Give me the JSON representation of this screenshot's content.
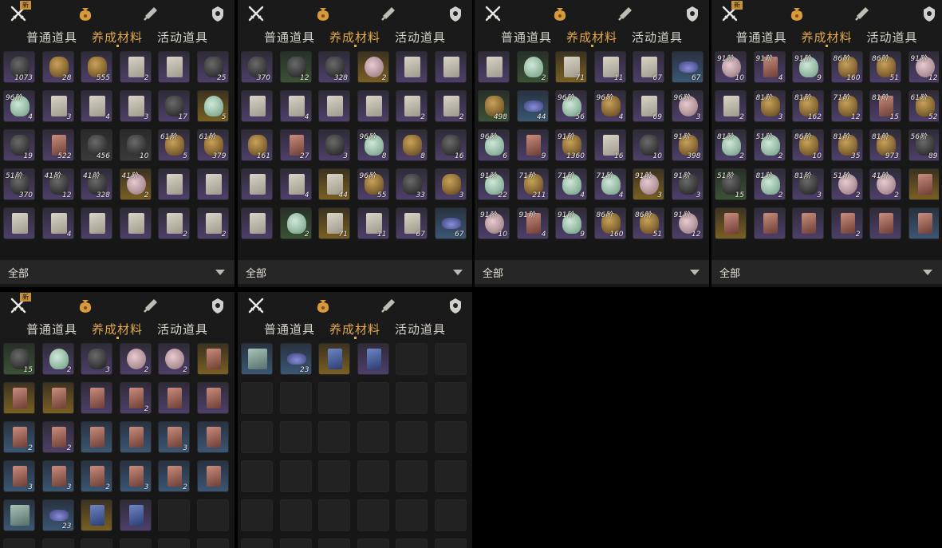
{
  "tabs": [
    "普通道具",
    "养成材料",
    "活动道具"
  ],
  "active_tab": 1,
  "new_badge": "新",
  "filter": {
    "selected": "全部"
  },
  "icons": [
    "crossed-swords-icon",
    "bag-icon",
    "scroll-icon",
    "shield-icon",
    "dropdown-arrow-icon"
  ],
  "colors": {
    "accent": "#e3a94a",
    "text": "#d8d4cc"
  },
  "panels": [
    {
      "id": "p0",
      "badge": true,
      "filter": true,
      "slots": [
        {
          "c": "purple",
          "i": "dark",
          "n": "1073"
        },
        {
          "c": "purple",
          "i": "ore",
          "n": "28"
        },
        {
          "c": "purple",
          "i": "ore",
          "n": "555"
        },
        {
          "c": "purple",
          "i": "paper",
          "n": "2"
        },
        {
          "c": "purple",
          "i": "paper",
          "n": ""
        },
        {
          "c": "purple",
          "i": "dark",
          "n": "25"
        },
        {
          "c": "purple",
          "i": "leaf",
          "t": "96阶",
          "n": "4"
        },
        {
          "c": "purple",
          "i": "paper",
          "n": "3"
        },
        {
          "c": "purple",
          "i": "paper",
          "n": "4"
        },
        {
          "c": "purple",
          "i": "paper",
          "n": "3"
        },
        {
          "c": "purple",
          "i": "dark",
          "n": "17"
        },
        {
          "c": "gold",
          "i": "leaf",
          "n": "5"
        },
        {
          "c": "purple",
          "i": "dark",
          "n": "19"
        },
        {
          "c": "purple",
          "i": "card",
          "n": "522"
        },
        {
          "c": "gray",
          "i": "dark",
          "n": "456"
        },
        {
          "c": "gray",
          "i": "dark",
          "n": "10"
        },
        {
          "c": "purple",
          "i": "ore",
          "t": "61阶",
          "n": "5"
        },
        {
          "c": "purple",
          "i": "ore",
          "t": "61阶",
          "n": "379"
        },
        {
          "c": "purple",
          "i": "dark",
          "t": "51阶",
          "n": "370"
        },
        {
          "c": "purple",
          "i": "dark",
          "t": "41阶",
          "n": "12"
        },
        {
          "c": "purple",
          "i": "dark",
          "t": "41阶",
          "n": "328"
        },
        {
          "c": "gold",
          "i": "shell",
          "t": "41阶",
          "n": "2"
        },
        {
          "c": "purple",
          "i": "paper",
          "n": ""
        },
        {
          "c": "purple",
          "i": "paper",
          "n": ""
        },
        {
          "c": "purple",
          "i": "paper",
          "n": ""
        },
        {
          "c": "purple",
          "i": "paper",
          "n": "4"
        },
        {
          "c": "purple",
          "i": "paper",
          "n": ""
        },
        {
          "c": "purple",
          "i": "paper",
          "n": ""
        },
        {
          "c": "purple",
          "i": "paper",
          "n": "2"
        },
        {
          "c": "purple",
          "i": "paper",
          "n": "2"
        }
      ]
    },
    {
      "id": "p1",
      "badge": false,
      "filter": true,
      "slots": [
        {
          "c": "purple",
          "i": "dark",
          "n": "370"
        },
        {
          "c": "green",
          "i": "dark",
          "n": "12"
        },
        {
          "c": "purple",
          "i": "dark",
          "n": "328"
        },
        {
          "c": "gold",
          "i": "shell",
          "n": "2"
        },
        {
          "c": "purple",
          "i": "paper",
          "n": ""
        },
        {
          "c": "purple",
          "i": "paper",
          "n": ""
        },
        {
          "c": "purple",
          "i": "paper",
          "n": ""
        },
        {
          "c": "purple",
          "i": "paper",
          "n": "4"
        },
        {
          "c": "purple",
          "i": "paper",
          "n": ""
        },
        {
          "c": "purple",
          "i": "paper",
          "n": ""
        },
        {
          "c": "purple",
          "i": "paper",
          "n": "2"
        },
        {
          "c": "purple",
          "i": "paper",
          "n": "2"
        },
        {
          "c": "purple",
          "i": "ore",
          "n": "161"
        },
        {
          "c": "purple",
          "i": "card",
          "n": "27"
        },
        {
          "c": "purple",
          "i": "dark",
          "n": "3"
        },
        {
          "c": "purple",
          "i": "leaf",
          "t": "96阶",
          "n": "8"
        },
        {
          "c": "purple",
          "i": "ore",
          "n": "8"
        },
        {
          "c": "purple",
          "i": "dark",
          "n": "16"
        },
        {
          "c": "purple",
          "i": "paper",
          "n": ""
        },
        {
          "c": "purple",
          "i": "paper",
          "n": "4"
        },
        {
          "c": "gold",
          "i": "paper",
          "n": "44"
        },
        {
          "c": "purple",
          "i": "ore",
          "t": "96阶",
          "n": "55"
        },
        {
          "c": "purple",
          "i": "dark",
          "n": "33"
        },
        {
          "c": "purple",
          "i": "ore",
          "n": "3"
        },
        {
          "c": "purple",
          "i": "paper",
          "n": ""
        },
        {
          "c": "green",
          "i": "leaf",
          "n": "2"
        },
        {
          "c": "gold",
          "i": "paper",
          "n": "71"
        },
        {
          "c": "purple",
          "i": "paper",
          "n": "11"
        },
        {
          "c": "purple",
          "i": "paper",
          "n": "67"
        },
        {
          "c": "blue",
          "i": "boat",
          "n": "67"
        }
      ]
    },
    {
      "id": "p2",
      "badge": false,
      "filter": true,
      "slots": [
        {
          "c": "purple",
          "i": "paper",
          "n": ""
        },
        {
          "c": "green",
          "i": "leaf",
          "n": "2"
        },
        {
          "c": "gold",
          "i": "paper",
          "n": "71"
        },
        {
          "c": "purple",
          "i": "paper",
          "n": "11"
        },
        {
          "c": "purple",
          "i": "paper",
          "n": "67"
        },
        {
          "c": "blue",
          "i": "boat",
          "n": "67"
        },
        {
          "c": "green",
          "i": "ore",
          "n": "498"
        },
        {
          "c": "blue",
          "i": "boat",
          "n": "44"
        },
        {
          "c": "purple",
          "i": "leaf",
          "t": "96阶",
          "n": "56"
        },
        {
          "c": "purple",
          "i": "ore",
          "t": "96阶",
          "n": "4"
        },
        {
          "c": "purple",
          "i": "paper",
          "n": "69"
        },
        {
          "c": "purple",
          "i": "shell",
          "t": "96阶",
          "n": "3"
        },
        {
          "c": "purple",
          "i": "leaf",
          "t": "96阶",
          "n": "6"
        },
        {
          "c": "purple",
          "i": "card",
          "n": "9"
        },
        {
          "c": "purple",
          "i": "ore",
          "t": "91阶",
          "n": "1360"
        },
        {
          "c": "purple",
          "i": "paper",
          "n": "16"
        },
        {
          "c": "purple",
          "i": "dark",
          "n": "10"
        },
        {
          "c": "purple",
          "i": "ore",
          "t": "91阶",
          "n": "398"
        },
        {
          "c": "purple",
          "i": "leaf",
          "t": "91阶",
          "n": "22"
        },
        {
          "c": "purple",
          "i": "ore",
          "t": "71阶",
          "n": "211"
        },
        {
          "c": "purple",
          "i": "leaf",
          "t": "71阶",
          "n": "4"
        },
        {
          "c": "purple",
          "i": "leaf",
          "t": "71阶",
          "n": "4"
        },
        {
          "c": "gold",
          "i": "shell",
          "t": "91阶",
          "n": "3"
        },
        {
          "c": "purple",
          "i": "dark",
          "t": "91阶",
          "n": "3"
        },
        {
          "c": "purple",
          "i": "shell",
          "t": "91阶",
          "n": "10"
        },
        {
          "c": "purple",
          "i": "card",
          "t": "91阶",
          "n": "4"
        },
        {
          "c": "purple",
          "i": "leaf",
          "t": "91阶",
          "n": "9"
        },
        {
          "c": "purple",
          "i": "ore",
          "t": "86阶",
          "n": "160"
        },
        {
          "c": "purple",
          "i": "ore",
          "t": "86阶",
          "n": "51"
        },
        {
          "c": "purple",
          "i": "shell",
          "t": "91阶",
          "n": "12"
        }
      ]
    },
    {
      "id": "p3",
      "badge": true,
      "filter": true,
      "slots": [
        {
          "c": "purple",
          "i": "shell",
          "t": "91阶",
          "n": "10"
        },
        {
          "c": "purple",
          "i": "card",
          "t": "91阶",
          "n": "4"
        },
        {
          "c": "purple",
          "i": "leaf",
          "t": "91阶",
          "n": "9"
        },
        {
          "c": "purple",
          "i": "ore",
          "t": "86阶",
          "n": "160"
        },
        {
          "c": "purple",
          "i": "ore",
          "t": "86阶",
          "n": "51"
        },
        {
          "c": "purple",
          "i": "shell",
          "t": "91阶",
          "n": "12"
        },
        {
          "c": "purple",
          "i": "paper",
          "n": "2"
        },
        {
          "c": "purple",
          "i": "ore",
          "t": "81阶",
          "n": "3"
        },
        {
          "c": "purple",
          "i": "ore",
          "t": "81阶",
          "n": "162"
        },
        {
          "c": "purple",
          "i": "ore",
          "t": "71阶",
          "n": "12"
        },
        {
          "c": "purple",
          "i": "card",
          "t": "81阶",
          "n": "15"
        },
        {
          "c": "purple",
          "i": "ore",
          "t": "61阶",
          "n": "52"
        },
        {
          "c": "purple",
          "i": "leaf",
          "t": "81阶",
          "n": "2"
        },
        {
          "c": "purple",
          "i": "leaf",
          "t": "51阶",
          "n": "2"
        },
        {
          "c": "purple",
          "i": "ore",
          "t": "86阶",
          "n": "10"
        },
        {
          "c": "purple",
          "i": "ore",
          "t": "81阶",
          "n": "35"
        },
        {
          "c": "purple",
          "i": "ore",
          "t": "81阶",
          "n": "973"
        },
        {
          "c": "purple",
          "i": "dark",
          "t": "56阶",
          "n": "89"
        },
        {
          "c": "green",
          "i": "dark",
          "t": "51阶",
          "n": "15"
        },
        {
          "c": "purple",
          "i": "leaf",
          "t": "81阶",
          "n": "2"
        },
        {
          "c": "purple",
          "i": "dark",
          "t": "81阶",
          "n": "3"
        },
        {
          "c": "purple",
          "i": "shell",
          "t": "51阶",
          "n": "2"
        },
        {
          "c": "purple",
          "i": "shell",
          "t": "41阶",
          "n": "2"
        },
        {
          "c": "gold",
          "i": "card",
          "n": ""
        },
        {
          "c": "gold",
          "i": "card",
          "n": ""
        },
        {
          "c": "purple",
          "i": "card",
          "n": ""
        },
        {
          "c": "purple",
          "i": "card",
          "n": ""
        },
        {
          "c": "purple",
          "i": "card",
          "n": "2"
        },
        {
          "c": "purple",
          "i": "card",
          "n": ""
        },
        {
          "c": "blue",
          "i": "card",
          "n": ""
        }
      ]
    },
    {
      "id": "p4",
      "badge": true,
      "filter": false,
      "slots": [
        {
          "c": "green",
          "i": "dark",
          "n": "15"
        },
        {
          "c": "purple",
          "i": "leaf",
          "n": "2"
        },
        {
          "c": "purple",
          "i": "dark",
          "n": "3"
        },
        {
          "c": "purple",
          "i": "shell",
          "n": "2"
        },
        {
          "c": "purple",
          "i": "shell",
          "n": "2"
        },
        {
          "c": "gold",
          "i": "card",
          "n": ""
        },
        {
          "c": "gold",
          "i": "card",
          "n": ""
        },
        {
          "c": "gold",
          "i": "card",
          "n": ""
        },
        {
          "c": "purple",
          "i": "card",
          "n": ""
        },
        {
          "c": "purple",
          "i": "card",
          "n": "2"
        },
        {
          "c": "purple",
          "i": "card",
          "n": ""
        },
        {
          "c": "purple",
          "i": "card",
          "n": ""
        },
        {
          "c": "blue",
          "i": "card",
          "n": "2"
        },
        {
          "c": "purple",
          "i": "card",
          "n": "2"
        },
        {
          "c": "blue",
          "i": "card",
          "n": ""
        },
        {
          "c": "blue",
          "i": "card",
          "n": ""
        },
        {
          "c": "blue",
          "i": "card",
          "n": "3"
        },
        {
          "c": "blue",
          "i": "card",
          "n": ""
        },
        {
          "c": "blue",
          "i": "card",
          "n": "3"
        },
        {
          "c": "blue",
          "i": "card",
          "n": "3"
        },
        {
          "c": "blue",
          "i": "card",
          "n": "2"
        },
        {
          "c": "blue",
          "i": "card",
          "n": "3"
        },
        {
          "c": "blue",
          "i": "card",
          "n": "2"
        },
        {
          "c": "blue",
          "i": "card",
          "n": ""
        },
        {
          "c": "blue",
          "i": "book",
          "n": ""
        },
        {
          "c": "blue",
          "i": "boat",
          "n": "23"
        },
        {
          "c": "gold",
          "i": "bluecard",
          "n": ""
        },
        {
          "c": "purple",
          "i": "bluecard",
          "n": ""
        },
        {
          "c": "empty",
          "i": "",
          "n": ""
        },
        {
          "c": "empty",
          "i": "",
          "n": ""
        },
        {
          "c": "empty",
          "i": "",
          "n": ""
        },
        {
          "c": "empty",
          "i": "",
          "n": ""
        },
        {
          "c": "empty",
          "i": "",
          "n": ""
        },
        {
          "c": "empty",
          "i": "",
          "n": ""
        },
        {
          "c": "empty",
          "i": "",
          "n": ""
        },
        {
          "c": "empty",
          "i": "",
          "n": ""
        }
      ]
    },
    {
      "id": "p5",
      "badge": false,
      "filter": false,
      "slots": [
        {
          "c": "blue",
          "i": "book",
          "n": ""
        },
        {
          "c": "blue",
          "i": "boat",
          "n": "23"
        },
        {
          "c": "gold",
          "i": "bluecard",
          "n": ""
        },
        {
          "c": "purple",
          "i": "bluecard",
          "n": ""
        },
        {
          "c": "empty",
          "i": "",
          "n": ""
        },
        {
          "c": "empty",
          "i": "",
          "n": ""
        },
        {
          "c": "empty",
          "i": "",
          "n": ""
        },
        {
          "c": "empty",
          "i": "",
          "n": ""
        },
        {
          "c": "empty",
          "i": "",
          "n": ""
        },
        {
          "c": "empty",
          "i": "",
          "n": ""
        },
        {
          "c": "empty",
          "i": "",
          "n": ""
        },
        {
          "c": "empty",
          "i": "",
          "n": ""
        },
        {
          "c": "empty",
          "i": "",
          "n": ""
        },
        {
          "c": "empty",
          "i": "",
          "n": ""
        },
        {
          "c": "empty",
          "i": "",
          "n": ""
        },
        {
          "c": "empty",
          "i": "",
          "n": ""
        },
        {
          "c": "empty",
          "i": "",
          "n": ""
        },
        {
          "c": "empty",
          "i": "",
          "n": ""
        },
        {
          "c": "empty",
          "i": "",
          "n": ""
        },
        {
          "c": "empty",
          "i": "",
          "n": ""
        },
        {
          "c": "empty",
          "i": "",
          "n": ""
        },
        {
          "c": "empty",
          "i": "",
          "n": ""
        },
        {
          "c": "empty",
          "i": "",
          "n": ""
        },
        {
          "c": "empty",
          "i": "",
          "n": ""
        },
        {
          "c": "empty",
          "i": "",
          "n": ""
        },
        {
          "c": "empty",
          "i": "",
          "n": ""
        },
        {
          "c": "empty",
          "i": "",
          "n": ""
        },
        {
          "c": "empty",
          "i": "",
          "n": ""
        },
        {
          "c": "empty",
          "i": "",
          "n": ""
        },
        {
          "c": "empty",
          "i": "",
          "n": ""
        },
        {
          "c": "empty",
          "i": "",
          "n": ""
        },
        {
          "c": "empty",
          "i": "",
          "n": ""
        },
        {
          "c": "empty",
          "i": "",
          "n": ""
        },
        {
          "c": "empty",
          "i": "",
          "n": ""
        },
        {
          "c": "empty",
          "i": "",
          "n": ""
        },
        {
          "c": "empty",
          "i": "",
          "n": ""
        }
      ]
    }
  ]
}
